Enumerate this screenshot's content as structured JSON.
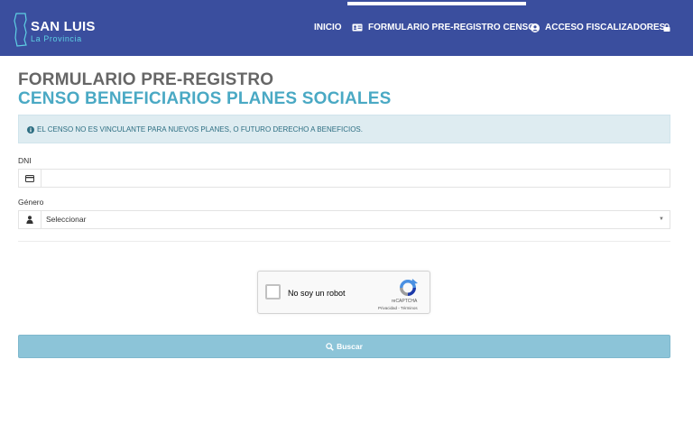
{
  "header": {
    "logo_title": "SAN LUIS",
    "logo_subtitle": "La Provincia",
    "nav": [
      {
        "label": "INICIO",
        "icon": ""
      },
      {
        "label": "FORMULARIO PRE-REGISTRO CENSO",
        "icon": "id-card-icon"
      },
      {
        "label": "ACCESO FISCALIZADORES",
        "icon": "user-circle-icon"
      }
    ],
    "lock_icon": "lock-icon"
  },
  "page": {
    "title_line1": "FORMULARIO PRE-REGISTRO",
    "title_line2": "CENSO BENEFICIARIOS PLANES SOCIALES"
  },
  "alert": {
    "icon": "info-circle-icon",
    "text": "EL CENSO NO ES VINCULANTE PARA NUEVOS PLANES, O FUTURO DERECHO A BENEFICIOS."
  },
  "form": {
    "dni": {
      "label": "DNI",
      "value": "",
      "icon": "credit-card-icon"
    },
    "genero": {
      "label": "Género",
      "selected": "Seleccionar",
      "icon": "user-icon"
    }
  },
  "captcha": {
    "checkbox_label": "No soy un robot",
    "brand": "reCAPTCHA",
    "links": "Privacidad - Términos"
  },
  "search_button": {
    "label": "Buscar",
    "icon": "search-icon"
  },
  "colors": {
    "navbar": "#3a4e9e",
    "title_gray": "#666666",
    "title_blue": "#4aa9c4",
    "alert_bg": "#deecf1",
    "button": "#8cc4d8"
  }
}
